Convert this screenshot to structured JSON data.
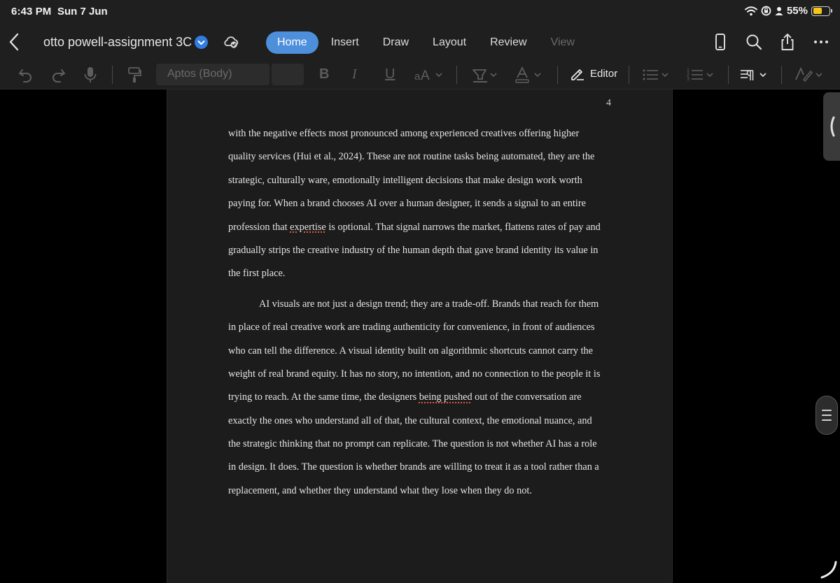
{
  "status": {
    "time": "6:43 PM",
    "date": "Sun 7 Jun",
    "battery": "55%"
  },
  "title": {
    "document_name": "otto powell-assignment 3C"
  },
  "tabs": [
    {
      "label": "Home",
      "active": true
    },
    {
      "label": "Insert",
      "active": false
    },
    {
      "label": "Draw",
      "active": false
    },
    {
      "label": "Layout",
      "active": false
    },
    {
      "label": "Review",
      "active": false
    },
    {
      "label": "View",
      "active": false
    }
  ],
  "ribbon": {
    "font_name": "Aptos (Body)",
    "editor_label": "Editor"
  },
  "colors": {
    "accent": "#4e8fdc",
    "battery": "#f5c518",
    "spellcheck": "#e0584a"
  },
  "document": {
    "page_number": "4",
    "para1": [
      "with the negative effects most pronounced among experienced creatives offering higher",
      "quality services (Hui et al., 2024). These are not routine tasks being automated, they are the",
      "strategic, culturally ware, emotionally intelligent decisions that make design work worth",
      "paying for. When a brand chooses AI over a human designer, it sends a signal to an entire",
      "profession that ",
      "expertise",
      " is optional. That signal narrows the market, flattens rates of pay and",
      "gradually strips the creative industry of the human depth that gave brand identity its value in",
      "the first place."
    ],
    "para2": [
      "AI visuals are not just a design trend; they are a trade-off. Brands that reach for them",
      "in place of real creative work are trading authenticity for convenience, in front of audiences",
      "who can tell the difference. A visual identity built on algorithmic shortcuts cannot carry the",
      "weight of real brand equity. It has no story, no intention, and no connection to the people it is",
      "trying to reach. At the same time, the designers ",
      "being pushed",
      " out of the conversation are",
      "exactly the ones who understand all of that, the cultural context, the emotional nuance, and",
      "the strategic thinking that no prompt can replicate. The question is not whether AI has a role",
      "in design. It does. The question is whether brands are willing to treat it as a tool rather than a",
      "replacement, and whether they understand what they lose when they do not."
    ]
  }
}
